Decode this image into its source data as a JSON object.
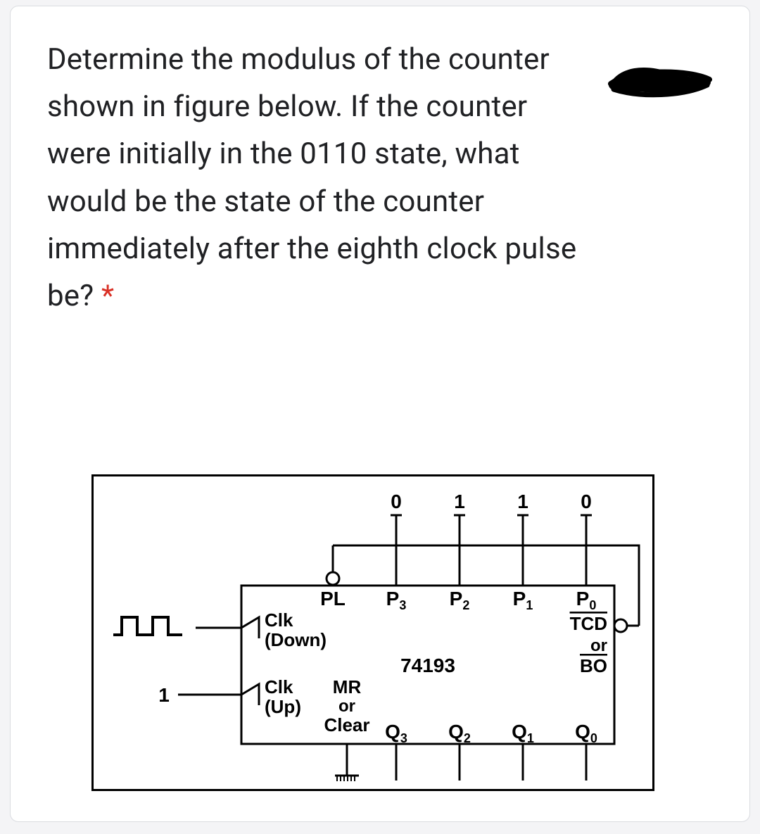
{
  "question": {
    "text": "Determine the modulus of the counter shown in figure below. If the counter were initially in the 0110 state, what would be the state of the counter immediately after the eighth clock pulse be? ",
    "required_mark": "*"
  },
  "figure": {
    "chip": "74193",
    "preset": {
      "p3": "0",
      "p2": "1",
      "p1": "1",
      "p0": "0"
    },
    "pins": {
      "pl": "PL",
      "p3": {
        "base": "P",
        "sub": "3"
      },
      "p2": {
        "base": "P",
        "sub": "2"
      },
      "p1": {
        "base": "P",
        "sub": "1"
      },
      "p0": {
        "base": "P",
        "sub": "0"
      }
    },
    "clk_down": {
      "l1": "Clk",
      "l2": "(Down)"
    },
    "clk_up": {
      "l1": "Clk",
      "l2": "(Up)"
    },
    "clk_up_value": "1",
    "mr": {
      "l1": "MR",
      "l2": "or",
      "l3": "Clear"
    },
    "tcdbo": {
      "l1": "TCD",
      "l2": "or",
      "l3": "BO"
    },
    "outs": {
      "q3": {
        "base": "Q",
        "sub": "3"
      },
      "q2": {
        "base": "Q",
        "sub": "2"
      },
      "q1": {
        "base": "Q",
        "sub": "1"
      },
      "q0": {
        "base": "Q",
        "sub": "0"
      }
    }
  }
}
